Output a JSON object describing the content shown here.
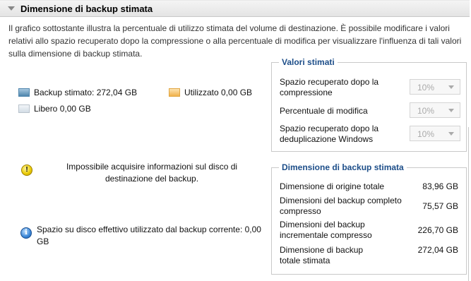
{
  "header": {
    "title": "Dimensione di backup stimata"
  },
  "intro_text": "Il grafico sottostante illustra la percentuale di utilizzo stimata del volume di destinazione. È possibile modificare i valori relativi allo spazio recuperato dopo la compressione o alla percentuale di modifica per visualizzare l'influenza di tali valori sulla dimensione di backup stimata.",
  "legend": {
    "backup": "Backup stimato: 272,04 GB",
    "used": "Utilizzato 0,00 GB",
    "free": "Libero 0,00 GB"
  },
  "messages": {
    "warning": "Impossibile acquisire informazioni sul disco di destinazione del backup.",
    "info": "Spazio su disco effettivo utilizzato dal backup corrente: 0,00 GB"
  },
  "estimated_values": {
    "title": "Valori stimati",
    "rows": [
      {
        "label": "Spazio recuperato dopo la compressione",
        "value": "10%"
      },
      {
        "label": "Percentuale di modifica",
        "value": "10%"
      },
      {
        "label": "Spazio recuperato dopo la deduplicazione Windows",
        "value": "10%"
      }
    ]
  },
  "backup_size": {
    "title": "Dimensione di backup stimata",
    "rows": [
      {
        "label": "Dimensione di origine totale",
        "value": "83,96 GB"
      },
      {
        "label": "Dimensioni del backup completo compresso",
        "value": "75,57 GB"
      },
      {
        "label": "Dimensioni del backup incrementale compresso",
        "value": "226,70 GB"
      },
      {
        "label": "Dimensione di backup totale stimata",
        "value": "272,04 GB"
      }
    ]
  },
  "colors": {
    "accent_title": "#1d4e89",
    "backup_swatch": "#4f86ad",
    "used_swatch": "#f0b24c",
    "free_swatch": "#d3dde6"
  }
}
